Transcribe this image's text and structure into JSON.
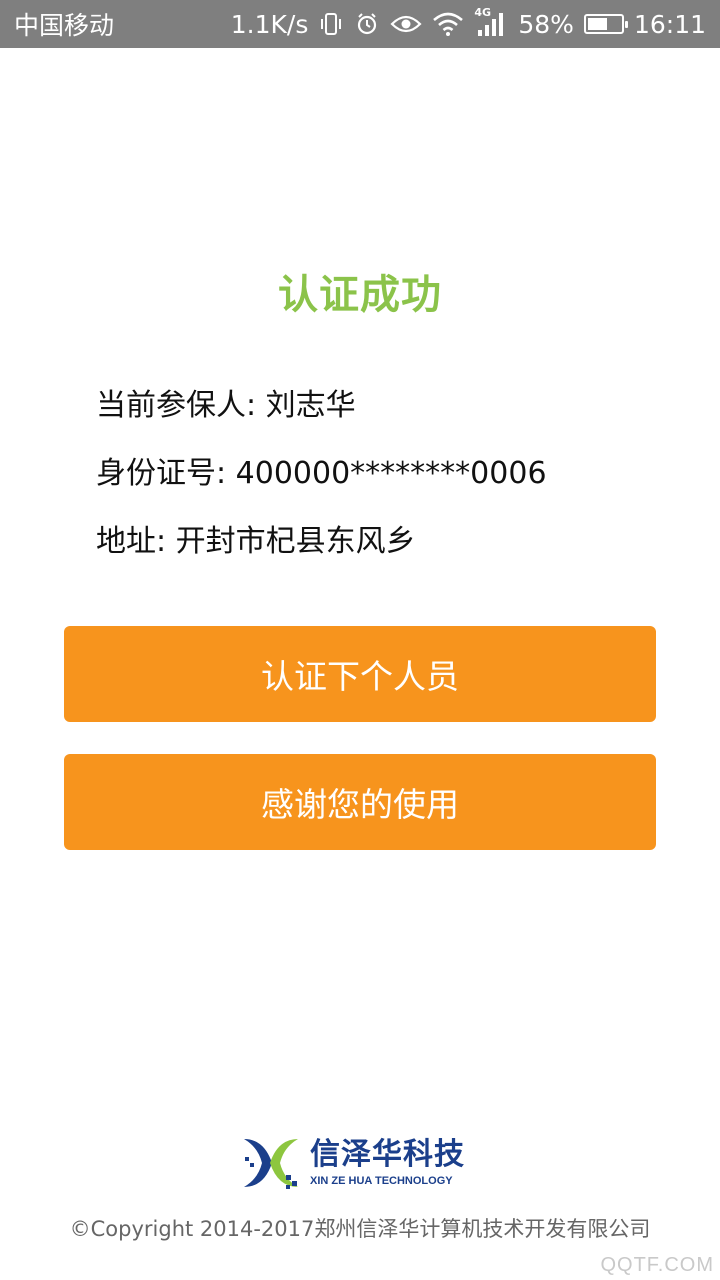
{
  "status_bar": {
    "carrier": "中国移动",
    "speed": "1.1K/s",
    "network": "4G",
    "battery_text": "58%",
    "battery_level": 0.58,
    "time": "16:11"
  },
  "result": {
    "title": "认证成功"
  },
  "info": {
    "insured_label": "当前参保人:",
    "insured_value": "刘志华",
    "id_label": "身份证号:",
    "id_value": "400000********0006",
    "address_label": "地址:",
    "address_value": "开封市杞县东风乡"
  },
  "buttons": {
    "next_label": "认证下个人员",
    "thanks_label": "感谢您的使用"
  },
  "footer": {
    "logo_name": "信泽华科技",
    "logo_sub": "XIN ZE HUA TECHNOLOGY",
    "copyright": "©Copyright 2014-2017郑州信泽华计算机技术开发有限公司"
  },
  "watermark": "QQTF.COM",
  "colors": {
    "title_green": "#8bc34a",
    "button_orange": "#f7941d",
    "brand_blue": "#1b3f8b",
    "brand_green": "#8dc63f",
    "status_bar_gray": "#7f7f7f"
  }
}
